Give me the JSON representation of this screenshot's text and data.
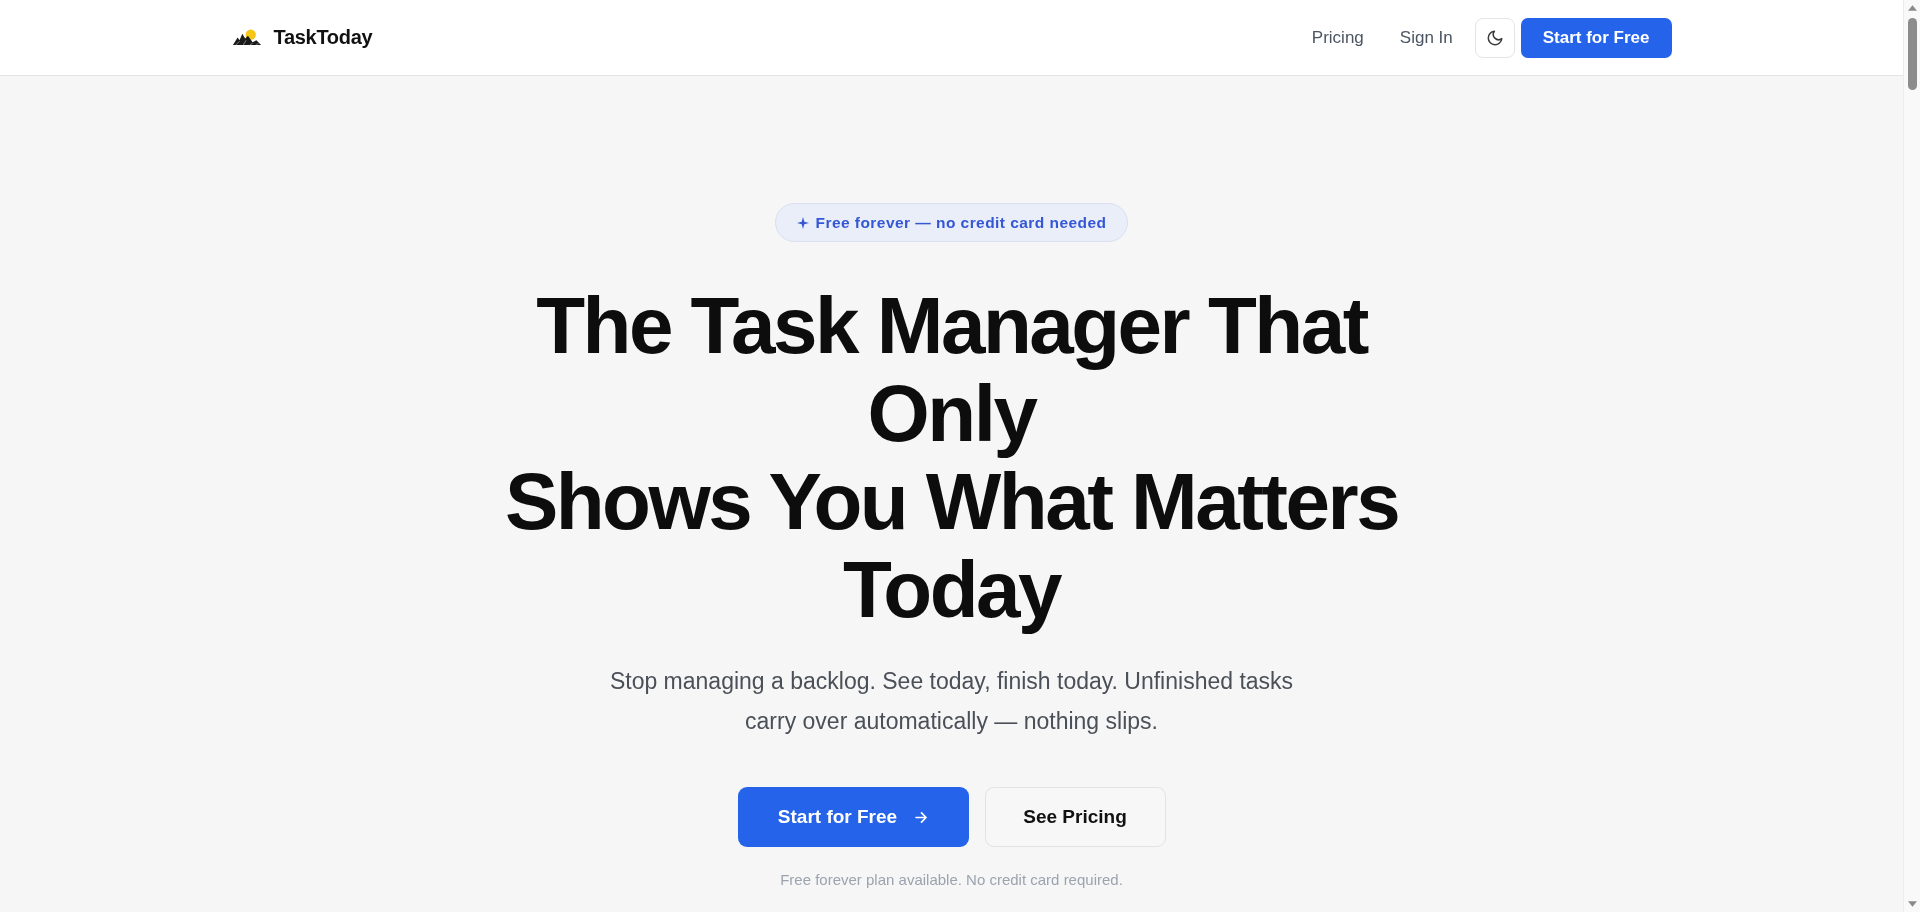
{
  "header": {
    "brand": "TaskToday",
    "nav": [
      {
        "label": "Pricing"
      },
      {
        "label": "Sign In"
      }
    ],
    "cta": "Start for Free"
  },
  "hero": {
    "badge": "Free forever — no credit card needed",
    "headline": [
      "The Task Manager That Only",
      "Shows You What Matters Today"
    ],
    "subtitle": "Stop managing a backlog. See today, finish today. Unfinished tasks carry over automatically — nothing slips.",
    "actions": [
      {
        "label": "Start for Free",
        "kind": "primary"
      },
      {
        "label": "See Pricing",
        "kind": "secondary"
      }
    ],
    "note": "Free forever plan available. No credit card required."
  }
}
